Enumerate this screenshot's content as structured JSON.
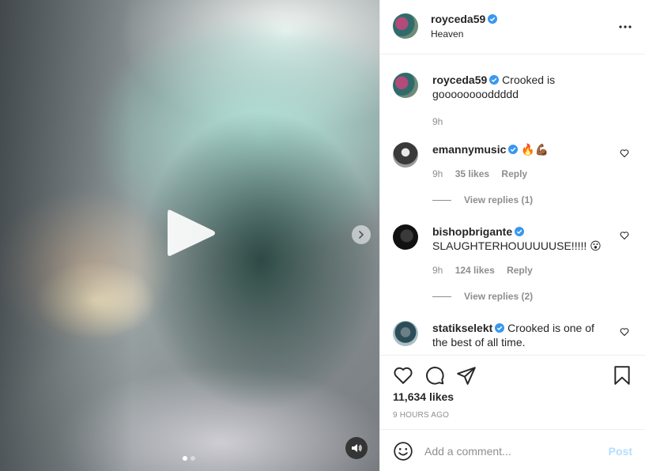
{
  "post": {
    "username": "royceda59",
    "location": "Heaven",
    "likes": "11,634 likes",
    "time_ago": "9 HOURS AGO",
    "media": {
      "type": "video",
      "slide_count": 2,
      "active_slide": 1
    }
  },
  "caption": {
    "username": "royceda59",
    "text": "Crooked is gooooooooddddd",
    "time": "9h"
  },
  "comments": [
    {
      "username": "emannymusic",
      "text": "🔥💪🏾",
      "time": "9h",
      "likes": "35 likes",
      "reply": "Reply",
      "view_replies": "View replies (1)"
    },
    {
      "username": "bishopbrigante",
      "text": "SLAUGHTERHOUUUUUSE!!!!! 😮",
      "time": "9h",
      "likes": "124 likes",
      "reply": "Reply",
      "view_replies": "View replies (2)"
    },
    {
      "username": "statikselekt",
      "text": "Crooked is one of the best of all time."
    }
  ],
  "add_comment": {
    "placeholder": "Add a comment...",
    "post_label": "Post"
  },
  "colors": {
    "verified": "#3897f0",
    "text": "#262626",
    "muted": "#8e8e8e",
    "post_disabled": "#b2dffc",
    "border": "#efefef"
  },
  "icons": [
    "play-icon",
    "next-icon",
    "mute-icon",
    "verified-icon",
    "more-icon",
    "heart-icon",
    "comment-icon",
    "share-icon",
    "bookmark-icon",
    "emoji-icon"
  ]
}
